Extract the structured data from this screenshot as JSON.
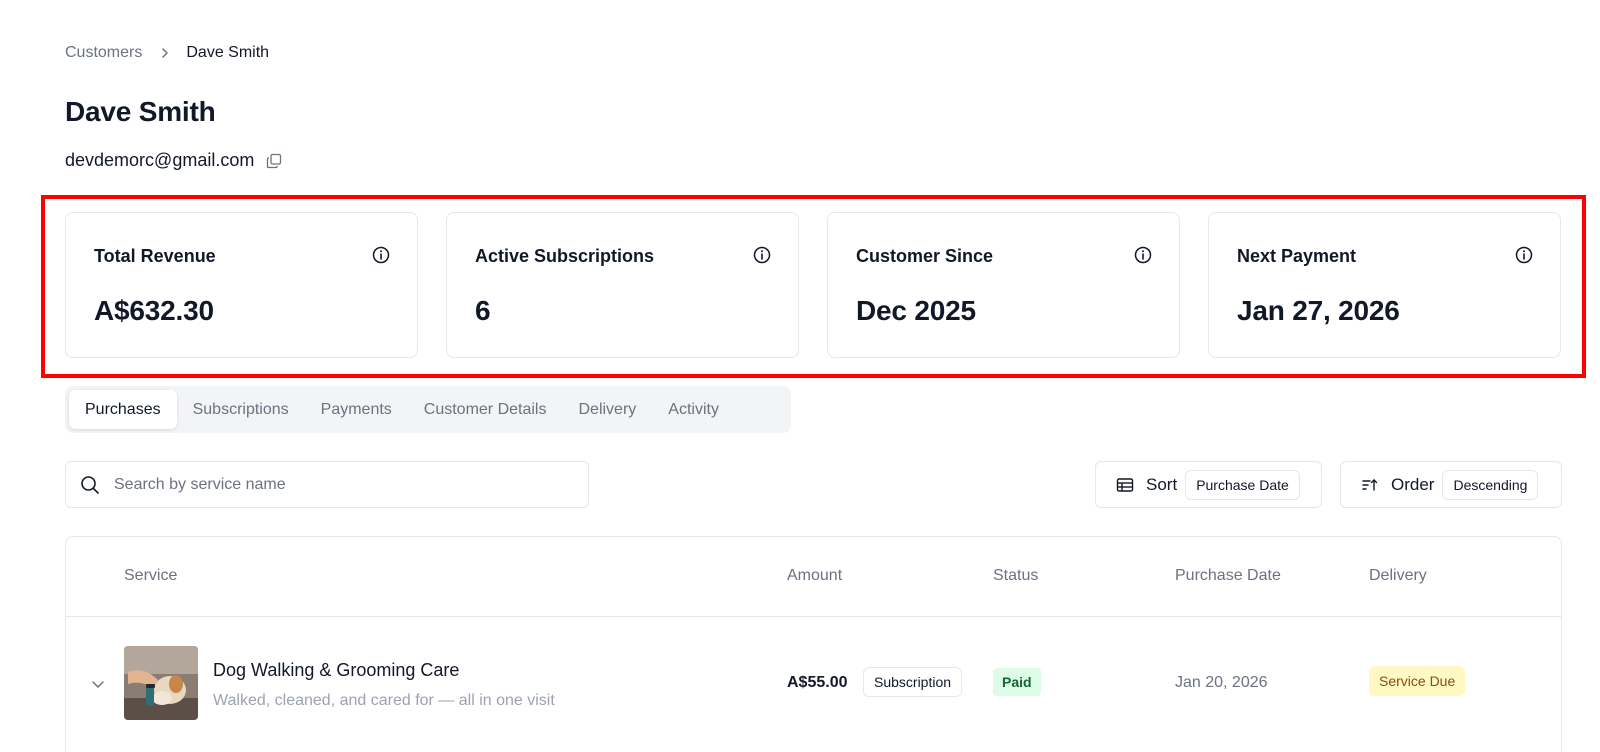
{
  "breadcrumb": {
    "parent": "Customers",
    "current": "Dave Smith"
  },
  "customer": {
    "name": "Dave Smith",
    "email": "devdemorc@gmail.com"
  },
  "stats": [
    {
      "label": "Total Revenue",
      "value": "A$632.30"
    },
    {
      "label": "Active Subscriptions",
      "value": "6"
    },
    {
      "label": "Customer Since",
      "value": "Dec 2025"
    },
    {
      "label": "Next Payment",
      "value": "Jan 27, 2026"
    }
  ],
  "tabs": [
    "Purchases",
    "Subscriptions",
    "Payments",
    "Customer Details",
    "Delivery",
    "Activity"
  ],
  "search": {
    "placeholder": "Search by service name"
  },
  "sort": {
    "label": "Sort",
    "value": "Purchase Date"
  },
  "order": {
    "label": "Order",
    "value": "Descending"
  },
  "table": {
    "headers": {
      "service": "Service",
      "amount": "Amount",
      "status": "Status",
      "purchase_date": "Purchase Date",
      "delivery": "Delivery"
    },
    "rows": [
      {
        "name": "Dog Walking & Grooming Care",
        "description": "Walked, cleaned, and cared for — all in one visit",
        "amount": "A$55.00",
        "type": "Subscription",
        "status": "Paid",
        "purchase_date": "Jan 20, 2026",
        "delivery": "Service Due"
      }
    ]
  },
  "colors": {
    "highlight": "#ff0000",
    "paid_bg": "#dcfce7",
    "paid_text": "#166534",
    "due_bg": "#fef9c3",
    "due_text": "#854d0e"
  }
}
